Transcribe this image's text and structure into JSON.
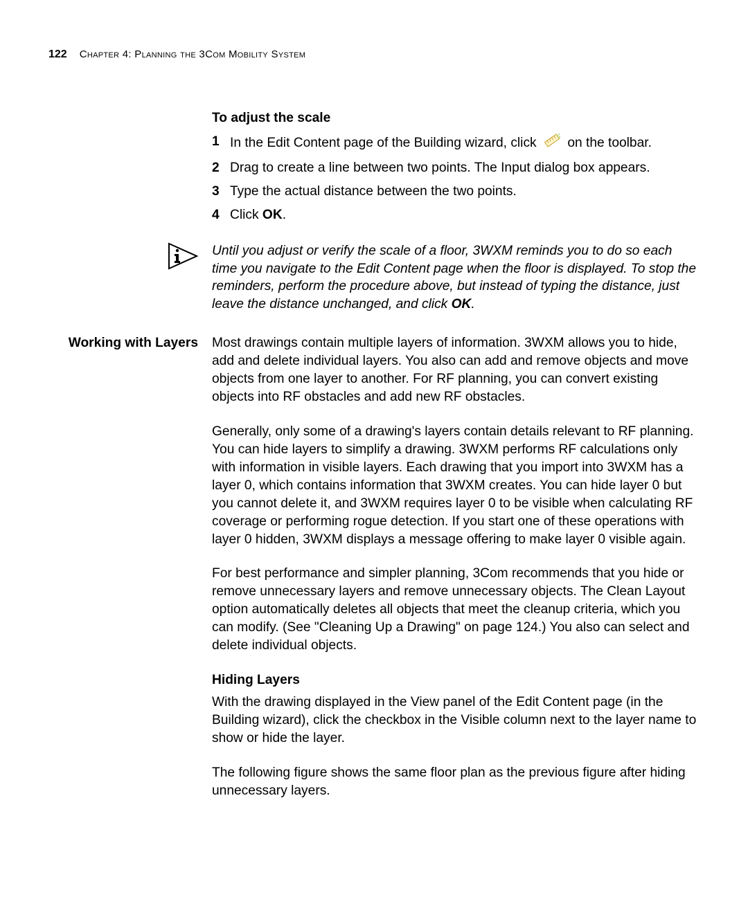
{
  "header": {
    "pageNumber": "122",
    "chapter": "Chapter 4: Planning the 3Com Mobility System"
  },
  "adjustScale": {
    "heading": "To adjust the scale",
    "stepNums": [
      "1",
      "2",
      "3",
      "4"
    ],
    "step1_a": "In the Edit Content page of the Building wizard, click ",
    "step1_b": " on the toolbar.",
    "step2": "Drag to create a line between two points. The Input dialog box appears.",
    "step3": "Type the actual distance between the two points.",
    "step4_a": "Click ",
    "step4_ok": "OK",
    "step4_b": "."
  },
  "note": {
    "text_a": "Until you adjust or verify the scale of a floor, 3WXM reminds you to do so each time you navigate to the Edit Content page when the floor is displayed. To stop the reminders, perform the procedure above, but instead of typing the distance, just leave the distance unchanged, and click ",
    "ok": "OK",
    "text_b": "."
  },
  "layers": {
    "sidebarTitle": "Working with Layers",
    "p1": "Most drawings contain multiple layers of information. 3WXM allows you to hide, add and delete individual layers. You also can add and remove objects and move objects from one layer to another. For RF planning, you can convert existing objects into RF obstacles and add new RF obstacles.",
    "p2": "Generally, only some of a drawing's layers contain details relevant to RF planning. You can hide layers to simplify a drawing. 3WXM performs RF calculations only with information in visible layers. Each drawing that you import into 3WXM has a layer 0, which contains information that 3WXM creates. You can hide layer 0 but you cannot delete it, and 3WXM requires layer 0 to be visible when calculating RF coverage or performing rogue detection. If you start one of these operations with layer 0 hidden, 3WXM displays a message offering to make layer 0 visible again.",
    "p3": "For best performance and simpler planning, 3Com recommends that you hide or remove unnecessary layers and remove unnecessary objects. The Clean Layout option automatically deletes all objects that meet the cleanup criteria, which you can modify. (See \"Cleaning Up a Drawing\" on page 124.) You also can select and delete individual objects.",
    "hidingHeading": "Hiding Layers",
    "p4": "With the drawing displayed in the View panel of the Edit Content page (in the Building wizard), click the checkbox in the Visible column next to the layer name to show or hide the layer.",
    "p5": "The following figure shows the same floor plan as the previous figure after hiding unnecessary layers."
  }
}
